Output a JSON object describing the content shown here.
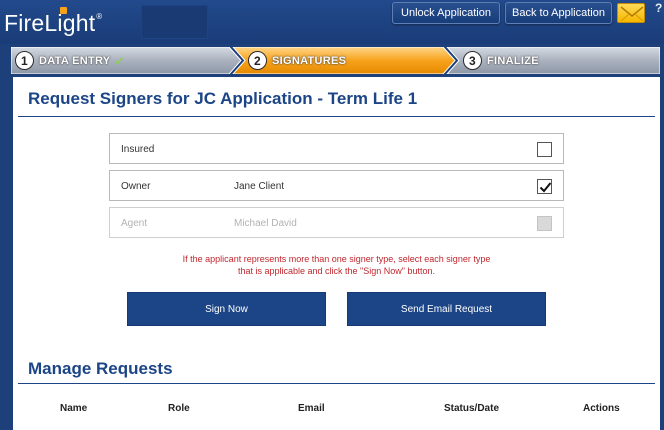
{
  "header": {
    "logo_text": "FireLight",
    "logo_mark": "®",
    "unlock_label": "Unlock Application",
    "back_label": "Back to Application",
    "mail_icon": "envelope-icon",
    "help_glyph": "?"
  },
  "steps": [
    {
      "number": "1",
      "label": "DATA ENTRY",
      "check": "✓",
      "state": "complete"
    },
    {
      "number": "2",
      "label": "SIGNATURES",
      "state": "active"
    },
    {
      "number": "3",
      "label": "FINALIZE",
      "state": "pending"
    }
  ],
  "colors": {
    "brand_blue": "#1c4587",
    "header_blue": "#1d3f7a",
    "active_step": "#f7a21b",
    "note_red": "#c0272d"
  },
  "request": {
    "title": "Request Signers for JC Application - Term Life 1",
    "signers": [
      {
        "role": "Insured",
        "name": "",
        "checked": false,
        "disabled": false
      },
      {
        "role": "Owner",
        "name": "Jane Client",
        "checked": true,
        "disabled": false
      },
      {
        "role": "Agent",
        "name": "Michael David",
        "checked": false,
        "disabled": true
      }
    ],
    "note_line1": "If the applicant represents more than one signer type, select each signer type",
    "note_line2": "that is applicable and click the \"Sign Now\" button.",
    "sign_now_label": "Sign Now",
    "send_email_label": "Send Email Request"
  },
  "manage": {
    "title": "Manage Requests",
    "columns": [
      "Name",
      "Role",
      "Email",
      "Status/Date",
      "Actions"
    ]
  }
}
